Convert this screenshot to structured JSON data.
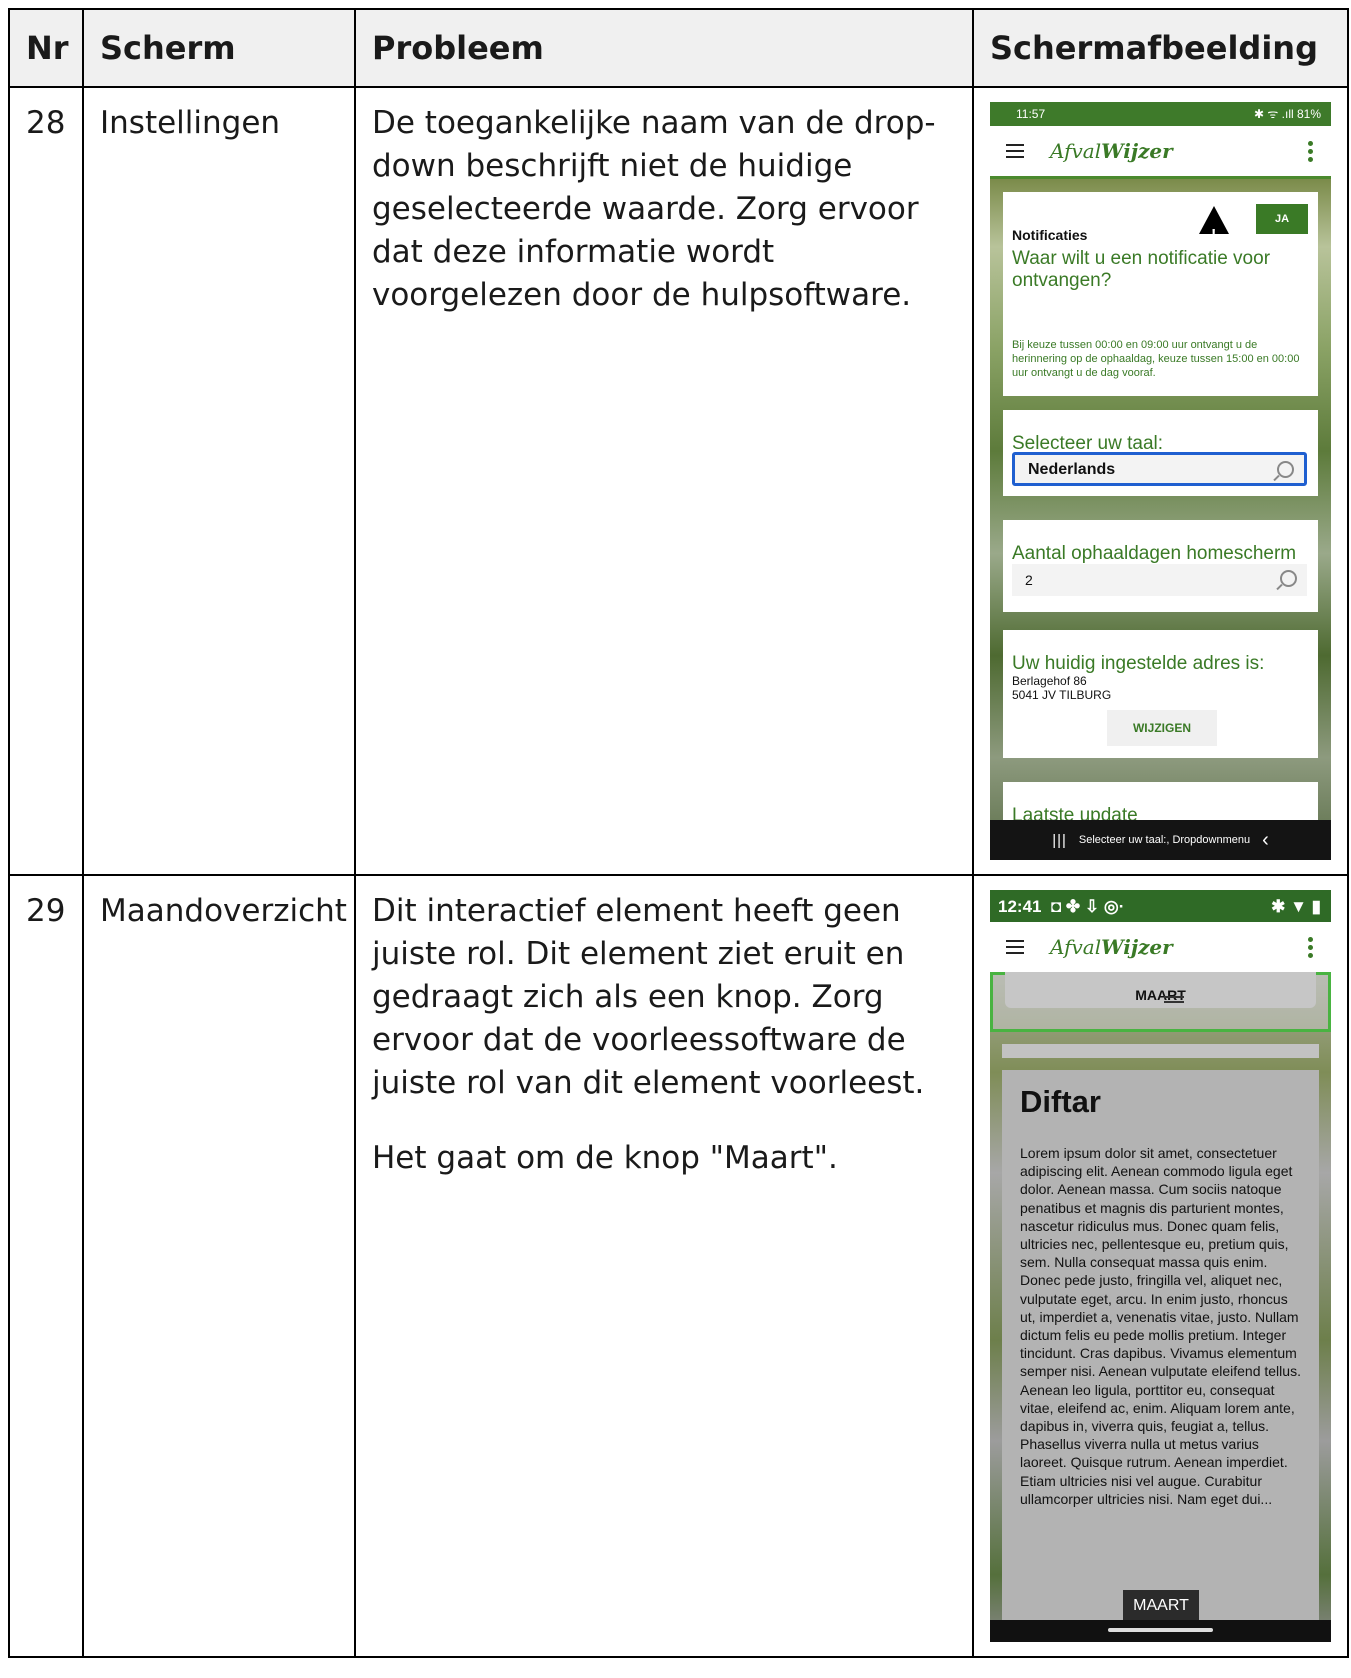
{
  "table": {
    "headers": [
      "Nr",
      "Scherm",
      "Probleem",
      "Schermafbeelding"
    ]
  },
  "rows": [
    {
      "nr": "28",
      "scherm": "Instellingen",
      "probleem": [
        "De toegankelijke naam van de drop-down beschrijft niet de huidige geselecteerde waarde. Zorg ervoor dat deze informatie wordt voorgelezen door de hulpsoftware."
      ]
    },
    {
      "nr": "29",
      "scherm": "Maandoverzicht",
      "probleem": [
        "Dit interactief element heeft geen juiste rol. Dit element ziet eruit en gedraagt zich als een knop. Zorg ervoor dat de voorleessoftware de juiste rol van dit element voorleest.",
        "Het gaat om de knop \"Maart\"."
      ]
    }
  ],
  "screenshot1": {
    "status_time": "11:57",
    "status_right": "✱ ᯤ .ıll 81%",
    "brand_light": "Afval",
    "brand_bold": "Wijzer",
    "notif_title": "Notificaties",
    "ja_button": "JA",
    "notif_question": "Waar wilt u een notificatie voor ontvangen?",
    "notif_hint": "Bij keuze tussen 00:00 en 09:00 uur ontvangt u de herinnering op de ophaaldag, keuze tussen 15:00 en 00:00 uur ontvangt u de dag vooraf.",
    "taal_label": "Selecteer uw taal:",
    "taal_value": "Nederlands",
    "aantal_label": "Aantal ophaaldagen homescherm",
    "aantal_value": "2",
    "adres_label": "Uw huidig ingestelde adres is:",
    "adres_line1": "Berlagehof 86",
    "adres_line2": "5041 JV TILBURG",
    "wijzigen_button": "WIJZIGEN",
    "update_label": "Laatste update",
    "nav_bars": "|||",
    "talkback_text": "Selecteer uw taal:, Dropdownmenu",
    "nav_back": "‹"
  },
  "screenshot2": {
    "status_time": "12:41",
    "status_icons": "◘ ✤ ⇩ ◎·",
    "status_right": "✱ ▼ ▮",
    "brand_light": "Afval",
    "brand_bold": "Wijzer",
    "maart_header": "MAART",
    "card_title": "Diftar",
    "card_body": "Lorem ipsum dolor sit amet, consectetuer adipiscing elit. Aenean commodo ligula eget dolor. Aenean massa. Cum sociis natoque penatibus et magnis dis parturient montes, nascetur ridiculus mus. Donec quam felis, ultricies nec, pellentesque eu, pretium quis, sem. Nulla consequat massa quis enim. Donec pede justo, fringilla vel, aliquet nec, vulputate eget, arcu. In enim justo, rhoncus ut, imperdiet a, venenatis vitae, justo. Nullam dictum felis eu pede mollis pretium. Integer tincidunt. Cras dapibus. Vivamus elementum semper nisi. Aenean vulputate eleifend tellus. Aenean leo ligula, porttitor eu, consequat vitae, eleifend ac, enim. Aliquam lorem ante, dapibus in, viverra quis, feugiat a, tellus. Phasellus viverra nulla ut metus varius laoreet. Quisque rutrum. Aenean imperdiet. Etiam ultricies nisi vel augue. Curabitur ullamcorper ultricies nisi. Nam eget dui...",
    "maart_button": "MAART"
  }
}
